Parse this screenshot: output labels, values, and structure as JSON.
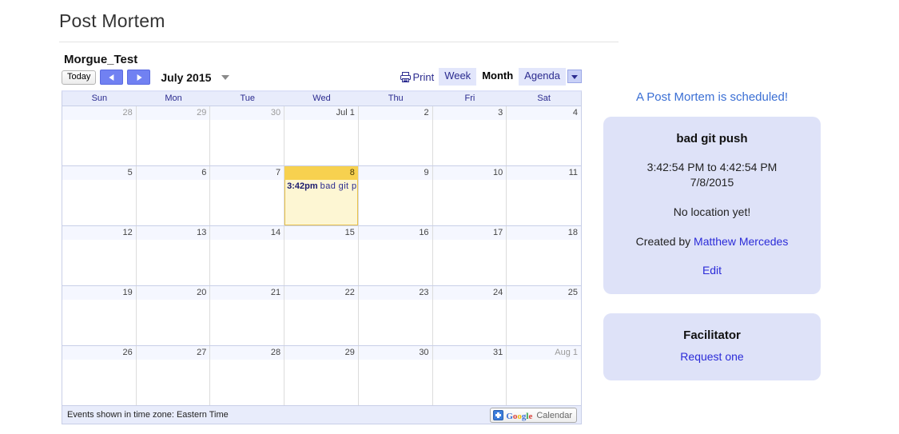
{
  "page": {
    "title": "Post Mortem"
  },
  "calendar": {
    "name": "Morgue_Test",
    "today_button": "Today",
    "period_label": "July 2015",
    "print_label": "Print",
    "views": [
      {
        "label": "Week",
        "active": false
      },
      {
        "label": "Month",
        "active": true
      },
      {
        "label": "Agenda",
        "active": false
      }
    ],
    "day_headers": [
      "Sun",
      "Mon",
      "Tue",
      "Wed",
      "Thu",
      "Fri",
      "Sat"
    ],
    "weeks": [
      [
        {
          "label": "28",
          "other_month": true
        },
        {
          "label": "29",
          "other_month": true
        },
        {
          "label": "30",
          "other_month": true
        },
        {
          "label": "Jul 1",
          "other_month": false
        },
        {
          "label": "2",
          "other_month": false
        },
        {
          "label": "3",
          "other_month": false
        },
        {
          "label": "4",
          "other_month": false
        }
      ],
      [
        {
          "label": "5",
          "other_month": false
        },
        {
          "label": "6",
          "other_month": false
        },
        {
          "label": "7",
          "other_month": false
        },
        {
          "label": "8",
          "other_month": false,
          "today": true,
          "event": {
            "time": "3:42pm",
            "title": "bad  git  p"
          }
        },
        {
          "label": "9",
          "other_month": false
        },
        {
          "label": "10",
          "other_month": false
        },
        {
          "label": "11",
          "other_month": false
        }
      ],
      [
        {
          "label": "12",
          "other_month": false
        },
        {
          "label": "13",
          "other_month": false
        },
        {
          "label": "14",
          "other_month": false
        },
        {
          "label": "15",
          "other_month": false
        },
        {
          "label": "16",
          "other_month": false
        },
        {
          "label": "17",
          "other_month": false
        },
        {
          "label": "18",
          "other_month": false
        }
      ],
      [
        {
          "label": "19",
          "other_month": false
        },
        {
          "label": "20",
          "other_month": false
        },
        {
          "label": "21",
          "other_month": false
        },
        {
          "label": "22",
          "other_month": false
        },
        {
          "label": "23",
          "other_month": false
        },
        {
          "label": "24",
          "other_month": false
        },
        {
          "label": "25",
          "other_month": false
        }
      ],
      [
        {
          "label": "26",
          "other_month": false
        },
        {
          "label": "27",
          "other_month": false
        },
        {
          "label": "28",
          "other_month": false
        },
        {
          "label": "29",
          "other_month": false
        },
        {
          "label": "30",
          "other_month": false
        },
        {
          "label": "31",
          "other_month": false
        },
        {
          "label": "Aug 1",
          "other_month": true
        }
      ]
    ],
    "footer": {
      "timezone_note": "Events shown in time zone: Eastern Time",
      "badge": {
        "google_letters": [
          "G",
          "o",
          "o",
          "g",
          "l",
          "e"
        ],
        "word": "Calendar"
      }
    }
  },
  "sidebar": {
    "heading": "A Post Mortem is scheduled!",
    "event_card": {
      "title": "bad git push",
      "time_range": "3:42:54 PM to 4:42:54 PM",
      "date": "7/8/2015",
      "location": "No location yet!",
      "created_prefix": "Created by ",
      "created_by": "Matthew Mercedes",
      "edit_label": "Edit"
    },
    "facilitator_card": {
      "title": "Facilitator",
      "request_label": "Request one"
    }
  },
  "colors": {
    "accent_blue": "#2b2b8f",
    "link_blue": "#2b2bd8",
    "heading_blue": "#3b6fd4",
    "today_header": "#f7d14f",
    "today_body": "#fdf6d3",
    "panel_bg": "#dee2f8",
    "grid_header_bg": "#e8ecfb"
  }
}
